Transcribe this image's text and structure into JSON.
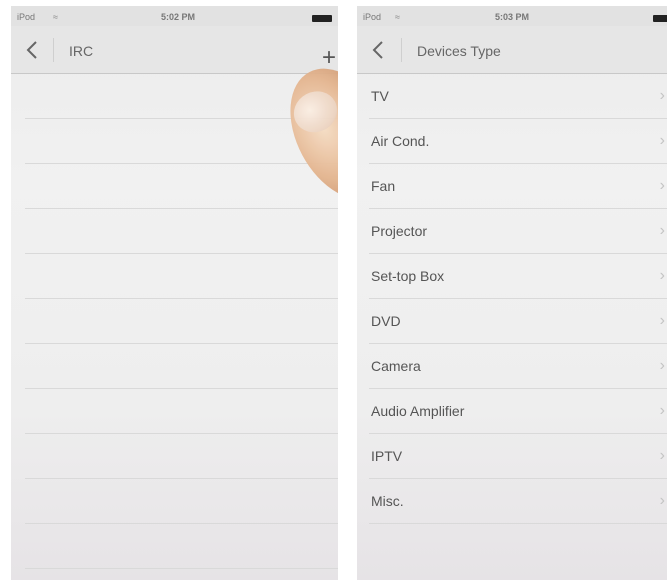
{
  "screens": [
    {
      "status": {
        "carrier": "iPod",
        "time": "5:02 PM"
      },
      "nav": {
        "title": "IRC",
        "back": "back",
        "add": "+"
      },
      "row_count": 11
    },
    {
      "status": {
        "carrier": "iPod",
        "time": "5:03 PM"
      },
      "nav": {
        "title": "Devices Type",
        "back": "back"
      },
      "items": [
        {
          "label": "TV"
        },
        {
          "label": "Air Cond."
        },
        {
          "label": "Fan"
        },
        {
          "label": "Projector"
        },
        {
          "label": "Set-top Box"
        },
        {
          "label": "DVD"
        },
        {
          "label": "Camera"
        },
        {
          "label": "Audio Amplifier"
        },
        {
          "label": "IPTV"
        },
        {
          "label": "Misc."
        }
      ]
    }
  ],
  "icons": {
    "back": "chevron-left-icon",
    "wifi": "wifi-icon",
    "battery": "battery-icon",
    "add": "plus-icon",
    "row": "chevron-right-icon"
  },
  "colors": {
    "background": "#eeeeee",
    "nav": "#e6e6e6",
    "divider": "#d9d9d9",
    "text": "#555555"
  }
}
